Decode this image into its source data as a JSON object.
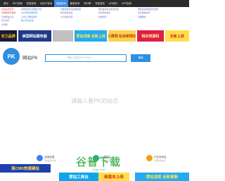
{
  "nav": {
    "items": [
      {
        "label": "首页",
        "active": false
      },
      {
        "label": "SEO查询",
        "active": false
      },
      {
        "label": "权重查询",
        "active": false
      },
      {
        "label": "站长IP查询",
        "active": false
      },
      {
        "label": "超级查询",
        "active": true
      },
      {
        "label": "备案查询",
        "active": false
      },
      {
        "label": "排行榜",
        "active": false
      },
      {
        "label": "有奖发帖",
        "active": false
      },
      {
        "label": "API接口",
        "active": false
      },
      {
        "label": "APP应用",
        "active": false
      }
    ]
  },
  "links": {
    "col1": [
      "先进站点走势",
      "互联网增长趋势",
      "可信网站认证",
      "实力排行",
      "访问量"
    ],
    "col2": [
      "谷歌百度优化保障计划",
      "2023年新闻源测评",
      "上市公司网站排行",
      "账户安全设置"
    ],
    "col3": [
      "谷歌百度优化连锁加盟",
      "神马收录最快",
      "大众化新闻源"
    ],
    "col4": [
      "网站收录提交收录设置",
      "安全防护监控",
      "权重测评"
    ],
    "col5": [
      "网站建设网站优化套餐",
      "专业网站装修",
      "清理网站"
    ]
  },
  "banners": [
    {
      "text": "实力品牌",
      "bg": "#1a1a3a",
      "fg": "#ffcc00"
    },
    {
      "text": "美国网站服务器",
      "bg": "#1e3a8a",
      "fg": "#ffffff"
    },
    {
      "text": "",
      "bg": "#c0c0c0",
      "fg": "#ffffff"
    },
    {
      "text": "爱站词库 全新上线",
      "bg": "#25aaf0",
      "fg": "#ffe94d"
    },
    {
      "text": "计费网 私存新网站",
      "bg": "#fcd34d",
      "fg": "#c2410c"
    },
    {
      "text": "相关类源码",
      "bg": "#e11d48",
      "fg": "#fff59d"
    },
    {
      "text": "全新上线",
      "bg": "#fde047",
      "fg": "#dc2626"
    }
  ],
  "search": {
    "logo_text": "PK",
    "site_name": "网站PK",
    "placeholder": "请输入域名进行PK对比",
    "button_label": "搜索"
  },
  "hint": "请输入要PK的站点",
  "tools": [
    {
      "label": "百度权重",
      "sub": "网站权重查询",
      "color": "#3b82f6"
    },
    {
      "label": "一键排名",
      "sub": "关键词排名",
      "color": "#10b981"
    },
    {
      "label": "IP反查域名",
      "sub": "同服务器站点",
      "color": "#f59e0b"
    }
  ],
  "bottom_banners": [
    {
      "text": "某CMS快速建站",
      "bg": "#1e40af",
      "fg": "#fde047"
    },
    {
      "text": "爱站工具包",
      "bg": "#0ea5e9",
      "fg": "#ffffff"
    },
    {
      "text": "新版本上线",
      "bg": "#fde047",
      "fg": "#dc2626"
    },
    {
      "text": "爱站词库 全新更新",
      "bg": "#25aaf0",
      "fg": "#ffe94d"
    }
  ],
  "watermark": {
    "text": "谷普下载",
    "sub": "Cngu.com"
  }
}
